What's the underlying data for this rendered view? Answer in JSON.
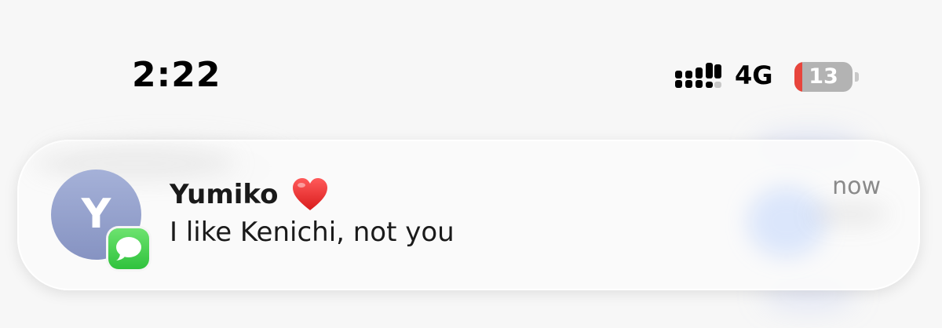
{
  "status_bar": {
    "time": "2:22",
    "network": "4G",
    "battery_level": "13",
    "battery_percent": 13,
    "signal_icon": "signal-bars-icon"
  },
  "notification": {
    "avatar_letter": "Y",
    "app_icon": "messages-icon",
    "sender": "Yumiko",
    "sender_emoji_icon": "red-heart-icon",
    "message": "I like Kenichi, not you",
    "timestamp": "now"
  },
  "colors": {
    "background": "#f7f7f7",
    "avatar_top": "#a5b1d8",
    "avatar_bottom": "#8693c2",
    "messages_green": "#34c759",
    "battery_low": "#e8453c",
    "battery_body": "#b3b3b3",
    "timestamp_text": "#8a8a8a"
  }
}
